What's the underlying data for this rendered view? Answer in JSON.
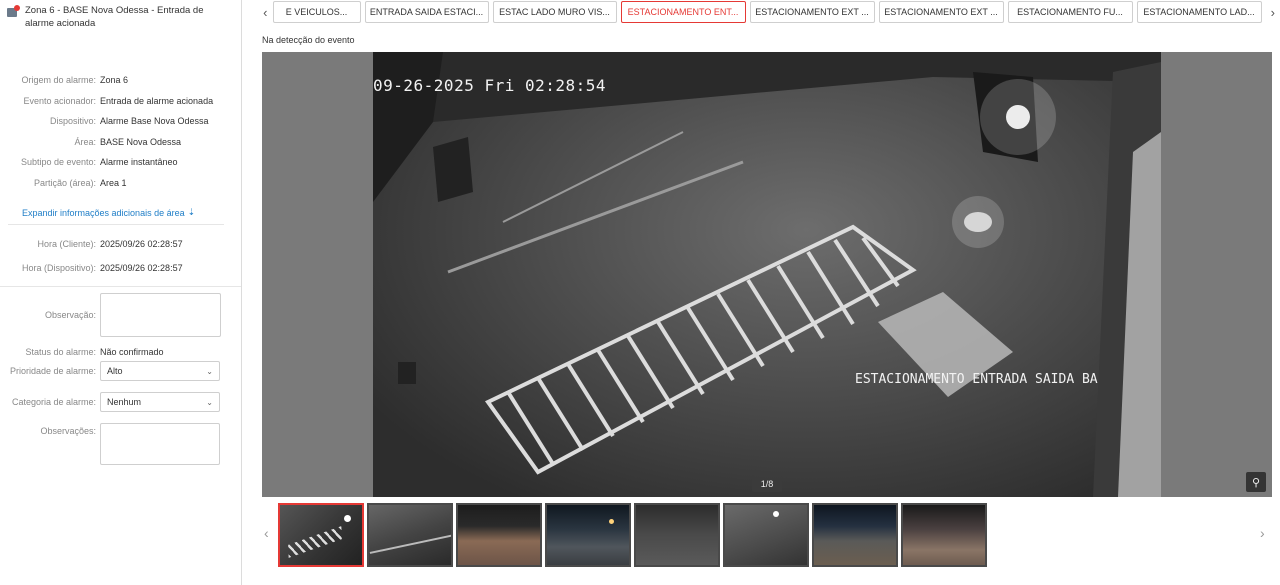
{
  "header": {
    "title": "Zona 6 - BASE Nova Odessa - Entrada de alarme acionada"
  },
  "details": [
    {
      "label": "Origem do alarme:",
      "value": "Zona 6"
    },
    {
      "label": "Evento acionador:",
      "value": "Entrada de alarme acionada"
    },
    {
      "label": "Dispositivo:",
      "value": "Alarme Base Nova Odessa"
    },
    {
      "label": "Área:",
      "value": "BASE Nova Odessa"
    },
    {
      "label": "Subtipo de evento:",
      "value": "Alarme instantâneo"
    },
    {
      "label": "Partição (área):",
      "value": "Area 1"
    }
  ],
  "expand_link": "Expandir informações adicionais de área",
  "times": {
    "client_label": "Hora (Cliente):",
    "client_value": "2025/09/26 02:28:57",
    "device_label": "Hora (Dispositivo):",
    "device_value": "2025/09/26 02:28:57"
  },
  "form": {
    "observation_label": "Observação:",
    "observation_value": "",
    "status_label": "Status do alarme:",
    "status_value": "Não confirmado",
    "priority_label": "Prioridade de alarme:",
    "priority_value": "Alto",
    "category_label": "Categoria de alarme:",
    "category_value": "Nenhum",
    "remarks_label": "Observações:",
    "remarks_value": ""
  },
  "tabs": [
    {
      "label": "E VEICULOS...",
      "active": false
    },
    {
      "label": "ENTRADA SAIDA ESTACI...",
      "active": false
    },
    {
      "label": "ESTAC LADO MURO VIS...",
      "active": false
    },
    {
      "label": "ESTACIONAMENTO ENT...",
      "active": true
    },
    {
      "label": "ESTACIONAMENTO EXT ...",
      "active": false
    },
    {
      "label": "ESTACIONAMENTO EXT ...",
      "active": false
    },
    {
      "label": "ESTACIONAMENTO FU...",
      "active": false
    },
    {
      "label": "ESTACIONAMENTO LAD...",
      "active": false
    }
  ],
  "viewer": {
    "event_label": "Na detecção do evento",
    "osd_time": "09-26-2025 Fri 02:28:54",
    "osd_camera": "ESTACIONAMENTO ENTRADA SAIDA BA",
    "counter": "1/8",
    "zoom_icon": "zoom-in-icon"
  },
  "thumbnails_count": 8,
  "colors": {
    "accent_red": "#e53935",
    "link_blue": "#1f7ec7"
  }
}
